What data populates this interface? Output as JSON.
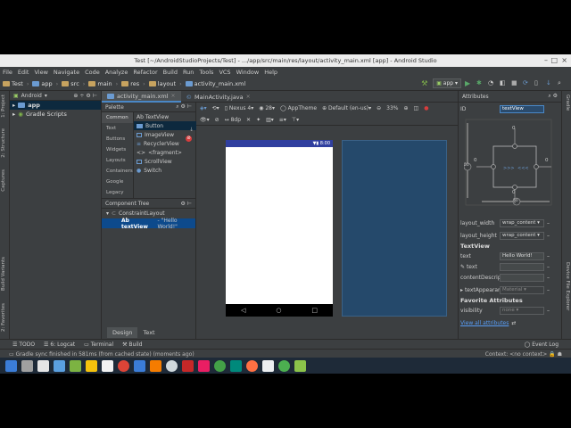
{
  "window": {
    "title": "Test [~/AndroidStudioProjects/Test] - .../app/src/main/res/layout/activity_main.xml [app] - Android Studio"
  },
  "menu": [
    "File",
    "Edit",
    "View",
    "Navigate",
    "Code",
    "Analyze",
    "Refactor",
    "Build",
    "Run",
    "Tools",
    "VCS",
    "Window",
    "Help"
  ],
  "breadcrumbs": [
    "Test",
    "app",
    "src",
    "main",
    "res",
    "layout",
    "activity_main.xml"
  ],
  "run_config": "app",
  "left_strip": [
    "1: Project",
    "2: Structure",
    "Captures",
    "Build Variants",
    "2: Favorites"
  ],
  "right_strip": [
    "Gradle",
    "Device File Explorer"
  ],
  "project": {
    "view_mode": "Android",
    "items": [
      {
        "label": "app",
        "selected": true
      },
      {
        "label": "Gradle Scripts",
        "selected": false
      }
    ]
  },
  "editor_tabs": [
    {
      "label": "activity_main.xml",
      "active": true
    },
    {
      "label": "MainActivity.java",
      "active": false
    }
  ],
  "palette": {
    "title": "Palette",
    "categories": [
      "Common",
      "Text",
      "Buttons",
      "Widgets",
      "Layouts",
      "Containers",
      "Google",
      "Legacy"
    ],
    "items": [
      "Ab TextView",
      "Button",
      "ImageView",
      "RecyclerView",
      "<fragment>",
      "ScrollView",
      "Switch"
    ]
  },
  "component_tree": {
    "title": "Component Tree",
    "items": [
      {
        "label": "ConstraintLayout",
        "hint": ""
      },
      {
        "label": "Ab textView",
        "hint": "- \"Hello World!\""
      }
    ]
  },
  "design_toolbar": {
    "device": "Nexus 4",
    "api": "28",
    "theme": "AppTheme",
    "locale": "Default (en-us)",
    "zoom": "33%",
    "dp": "8dp"
  },
  "phone": {
    "clock": "8:00"
  },
  "design_tabs": [
    "Design",
    "Text"
  ],
  "attributes": {
    "title": "Attributes",
    "id_label": "ID",
    "id_value": "textView",
    "constraint_margins": [
      "0",
      "0",
      "0",
      "0"
    ],
    "bias": "50",
    "layout_width_label": "layout_width",
    "layout_width": "wrap_content",
    "layout_height_label": "layout_height",
    "layout_height": "wrap_content",
    "section_textview": "TextView",
    "text_label": "text",
    "text_value": "Hello World!",
    "text_tools_label": "text",
    "content_desc_label": "contentDescript",
    "text_appearance_label": "textAppearan",
    "text_appearance": "Material",
    "section_favorite": "Favorite Attributes",
    "visibility_label": "visibility",
    "visibility": "none",
    "view_all": "View all attributes"
  },
  "tool_windows": [
    "TODO",
    "6: Logcat",
    "Terminal",
    "Build"
  ],
  "event_log": "Event Log",
  "status": {
    "message": "Gradle sync finished in 581ms (from cached state) (moments ago)",
    "context": "Context: <no context>"
  },
  "colors": {
    "ide_bg": "#3c3f41",
    "selection": "#0d4a8c",
    "accent": "#4a88c7",
    "phone_status": "#303f9f",
    "blueprint": "#25496b"
  }
}
